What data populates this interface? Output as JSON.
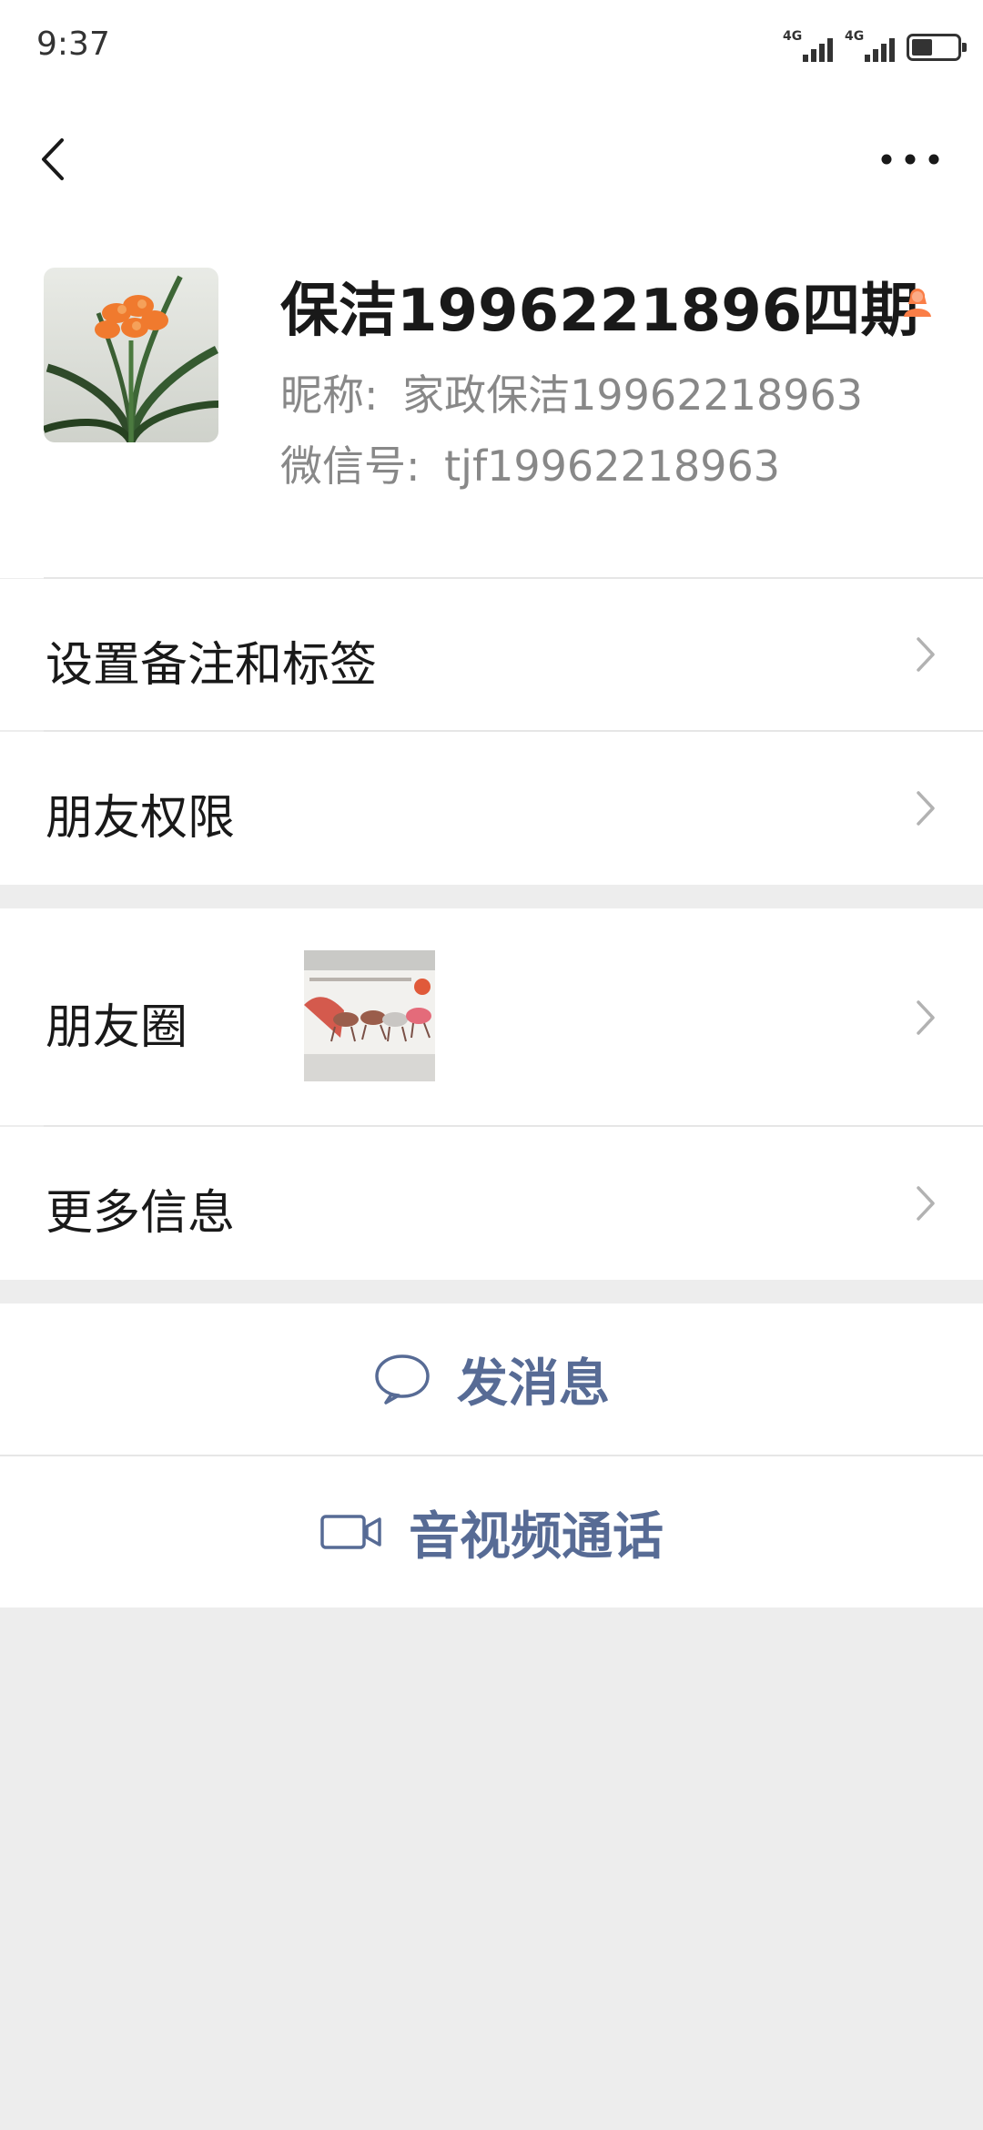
{
  "status_bar": {
    "time": "9:37",
    "signal_1_label": "4G",
    "signal_2_label": "4G",
    "battery_level": 0.45
  },
  "nav": {
    "back_icon": "chevron-left-icon",
    "more_icon": "more-dots-icon"
  },
  "profile": {
    "display_name": "保洁1996221896四期",
    "gender_icon": "female-icon",
    "nickname_label": "昵称:",
    "nickname_value": "家政保洁19962218963",
    "wechat_id_label": "微信号:",
    "wechat_id_value": "tjf19962218963"
  },
  "menu": {
    "remark_tags": "设置备注和标签",
    "friend_permissions": "朋友权限",
    "moments": "朋友圈",
    "more_info": "更多信息"
  },
  "actions": {
    "send_message": "发消息",
    "video_call": "音视频通话"
  },
  "colors": {
    "link_blue": "#576b95",
    "background": "#ededed",
    "gender_orange": "#fa7e47"
  }
}
